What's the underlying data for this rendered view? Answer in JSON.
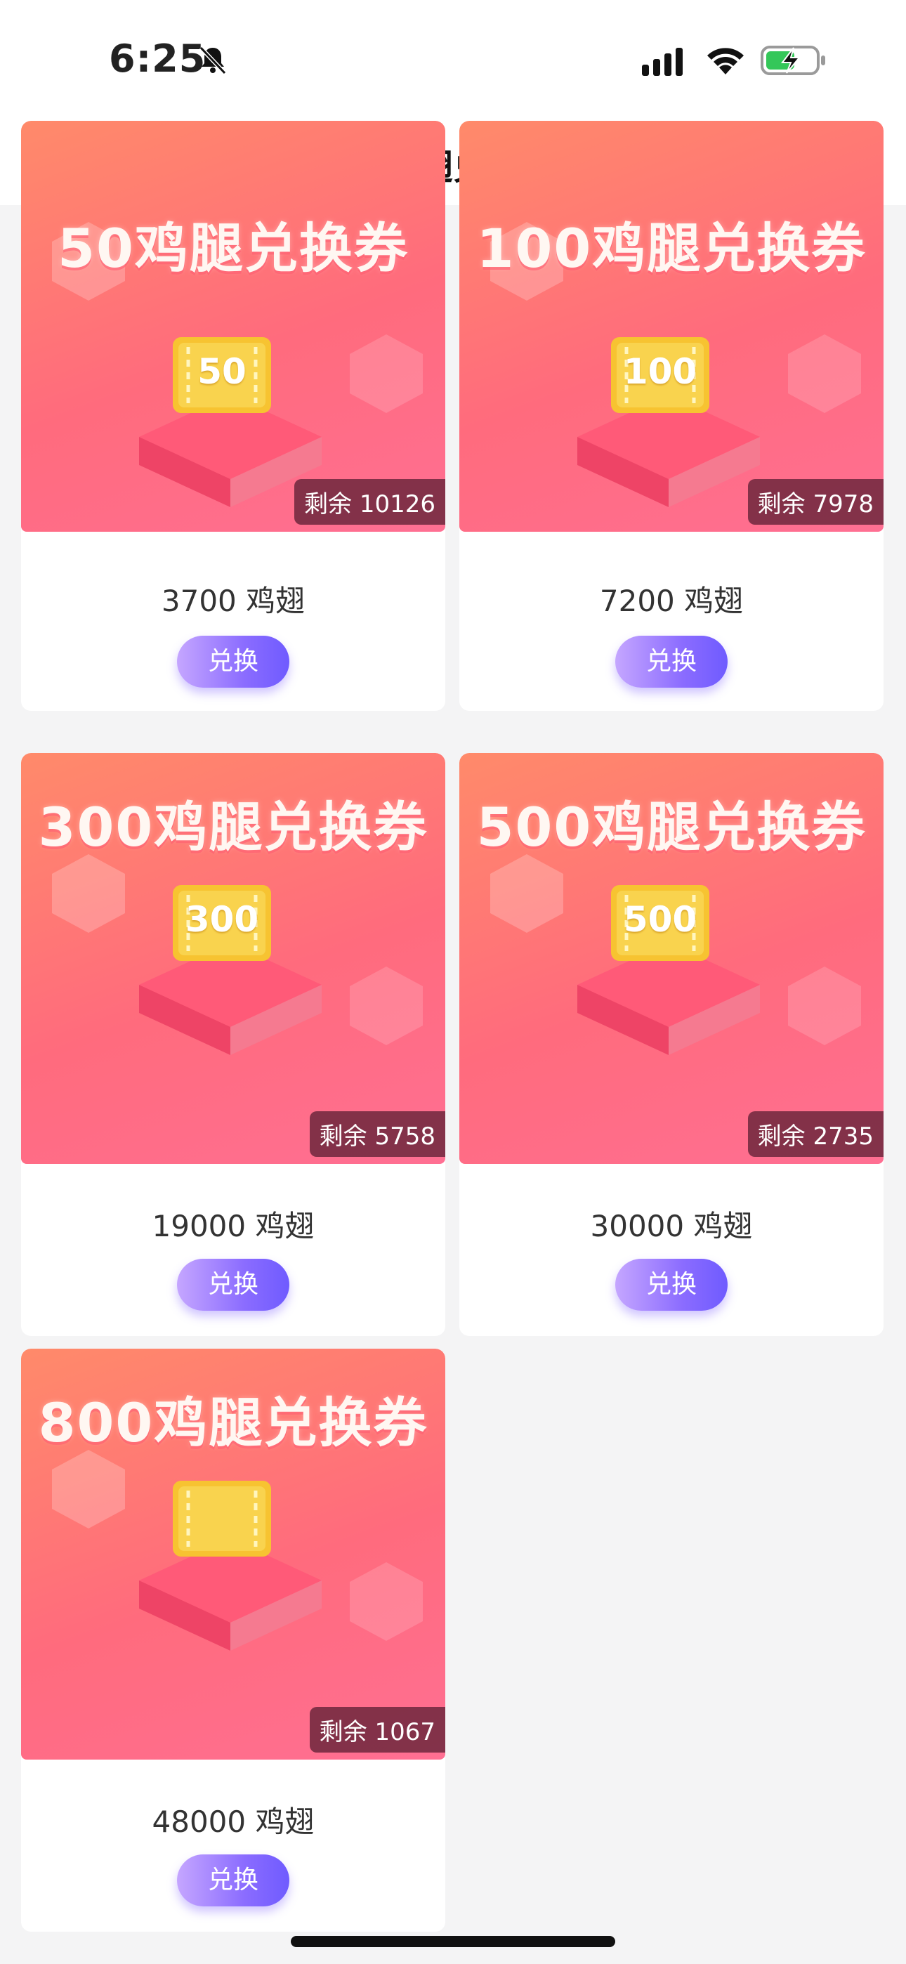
{
  "status": {
    "time": "6:25"
  },
  "header": {
    "title": "鸡翅兑换"
  },
  "items": [
    {
      "banner_title": "50鸡腿兑换券",
      "coupon": "50",
      "stock": "剩余 10126",
      "price": "3700 鸡翅",
      "button": "兑换"
    },
    {
      "banner_title": "100鸡腿兑换券",
      "coupon": "100",
      "stock": "剩余 7978",
      "price": "7200 鸡翅",
      "button": "兑换"
    },
    {
      "banner_title": "300鸡腿兑换券",
      "coupon": "300",
      "stock": "剩余 5758",
      "price": "19000 鸡翅",
      "button": "兑换"
    },
    {
      "banner_title": "500鸡腿兑换券",
      "coupon": "500",
      "stock": "剩余 2735",
      "price": "30000 鸡翅",
      "button": "兑换"
    },
    {
      "banner_title": "800鸡腿兑换券",
      "coupon": "",
      "stock": "剩余 1067",
      "price": "48000 鸡翅",
      "button": "兑换"
    }
  ],
  "colors": {
    "banner_start": "#ff8a6a",
    "banner_end": "#ff6f93",
    "button_start": "#c5a6ff",
    "button_end": "#6f5bff"
  },
  "icons": {
    "back": "chevron-left-icon",
    "bell": "bell-slash-icon",
    "signal": "signal-bars-icon",
    "wifi": "wifi-icon",
    "battery": "battery-charging-icon"
  }
}
